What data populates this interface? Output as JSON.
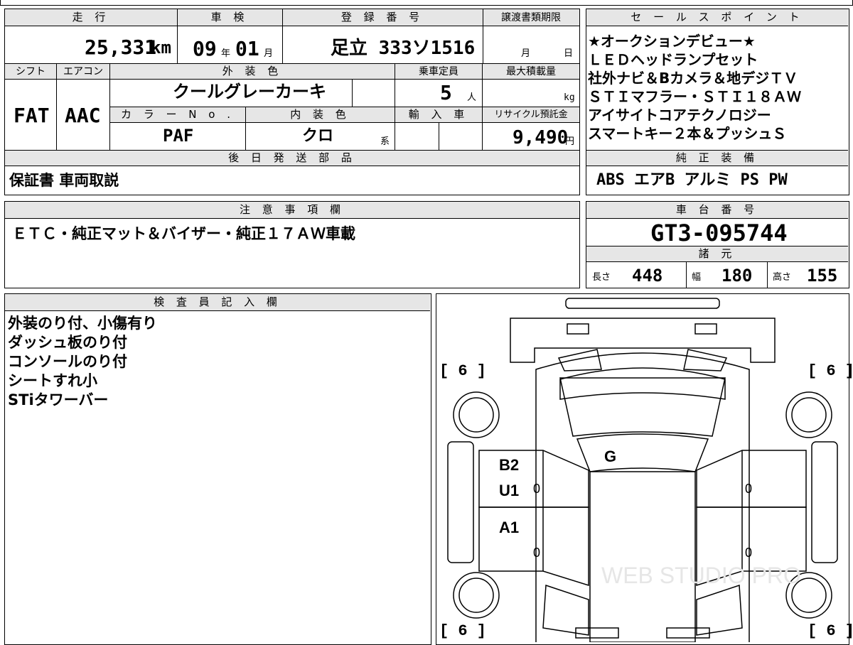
{
  "top": {
    "mileage_header": "走 行",
    "mileage_value": "25,331",
    "mileage_unit": "km",
    "inspection_header": "車 検",
    "inspection_year": "09",
    "inspection_year_unit": "年",
    "inspection_month": "01",
    "inspection_month_unit": "月",
    "registration_header": "登 録 番 号",
    "registration_value": "足立 333ソ1516",
    "transfer_header": "譲渡書類期限",
    "transfer_month_unit": "月",
    "transfer_day_unit": "日"
  },
  "spec": {
    "shift_header": "シフト",
    "shift_value": "FAT",
    "ac_header": "エアコン",
    "ac_value": "AAC",
    "exterior_header": "外 装 色",
    "exterior_value": "クールグレーカーキ",
    "capacity_header": "乗車定員",
    "capacity_value": "5",
    "capacity_unit": "人",
    "load_header": "最大積載量",
    "load_unit": "kg",
    "colorno_header": "カ ラ ー N o .",
    "colorno_value": "PAF",
    "interior_header": "内 装 色",
    "interior_value": "クロ",
    "interior_suffix": "系",
    "import_header": "輸 入 車",
    "recycle_header": "リサイクル預託金",
    "recycle_value": "9,490",
    "recycle_unit": "円"
  },
  "later_parts": {
    "header": "後 日 発 送 部 品",
    "value": "保証書 車両取説"
  },
  "sales_points": {
    "header": "セ ー ル ス ポ イ ン ト",
    "lines": [
      "★オークションデビュー★",
      "ＬＥＤヘッドランプセット",
      "社外ナビ＆Bカメラ＆地デジＴＶ",
      "ＳＴＩマフラー・ＳＴＩ１８ＡＷ",
      "アイサイトコアテクノロジー",
      "スマートキー２本＆プッシュＳ"
    ]
  },
  "equipment": {
    "header": "純 正 装 備",
    "value": "ABS エアB アルミ PS PW"
  },
  "notes": {
    "header": "注 意 事 項 欄",
    "value": "ＥＴＣ・純正マット＆バイザー・純正１７ＡＷ車載"
  },
  "chassis": {
    "header": "車 台 番 号",
    "value": "GT3-095744"
  },
  "dimensions": {
    "header": "諸 元",
    "length_label": "長さ",
    "length_value": "448",
    "width_label": "幅",
    "width_value": "180",
    "height_label": "高さ",
    "height_value": "155"
  },
  "inspector": {
    "header": "検 査 員 記 入 欄",
    "lines": [
      "外装のり付、小傷有り",
      "ダッシュ板のり付",
      "コンソールのり付",
      "シートすれ小",
      "STiタワーバー"
    ]
  },
  "diagram": {
    "tire_top_left": "6",
    "tire_top_right": "6",
    "tire_bottom_left": "6",
    "tire_bottom_right": "6",
    "mark_g": "G",
    "mark_b2": "B2",
    "mark_u1": "U1",
    "mark_a1": "A1",
    "zero_1": "0",
    "zero_2": "0",
    "zero_3": "0",
    "zero_4": "0",
    "watermark": "WEB STUDIO PRO"
  }
}
